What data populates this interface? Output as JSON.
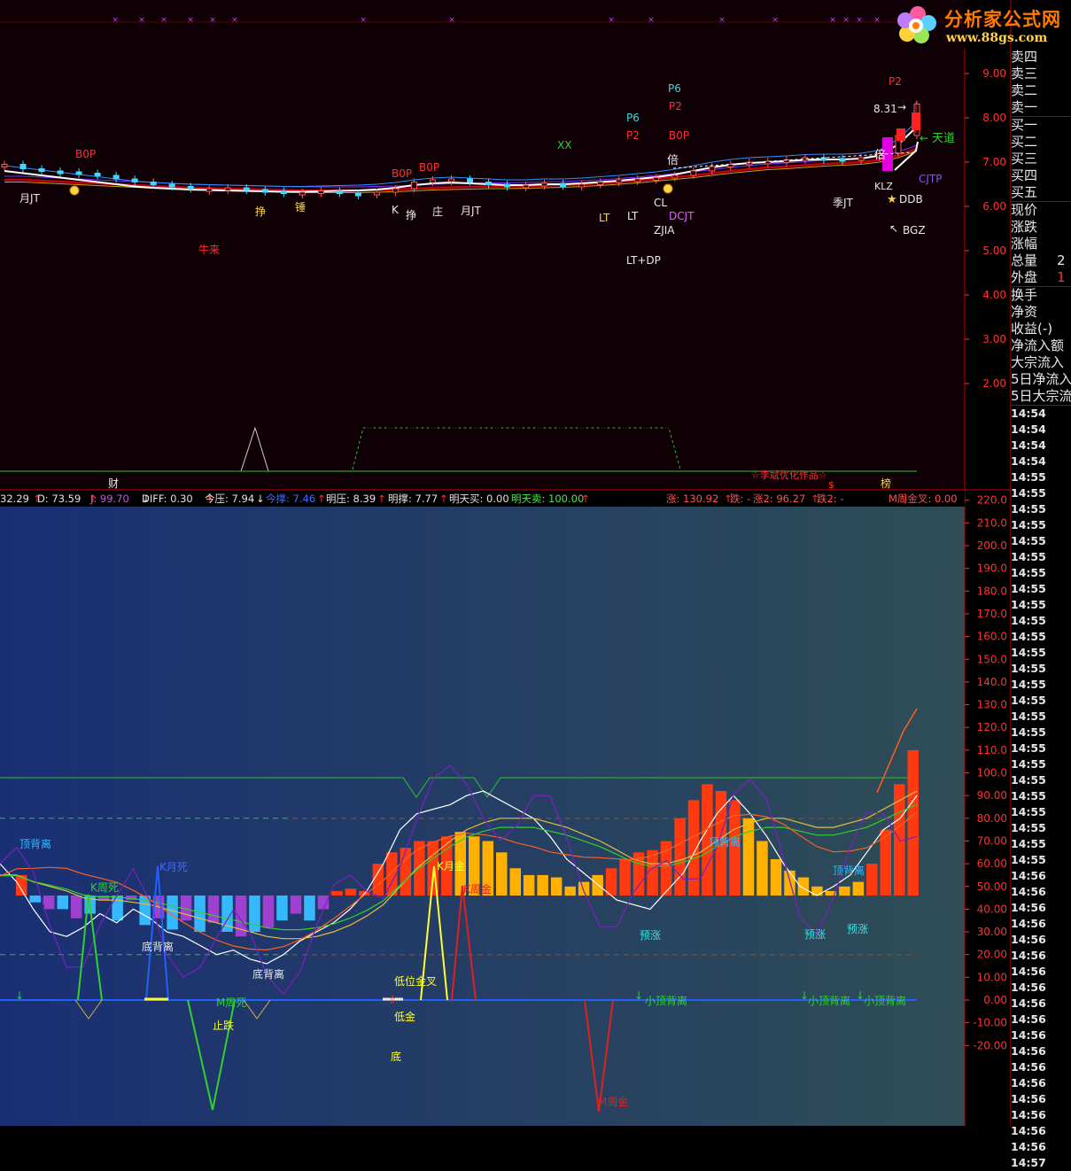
{
  "logo": {
    "title": "分析家公式网",
    "url_text": "www.88gs.com"
  },
  "colors": {
    "upper_bg": "#0f0005",
    "lower_bg_left": "#1a2f73",
    "lower_bg_right": "#2f4d56",
    "up": "#ff2a2a",
    "down": "#36c9ff",
    "grid": "#7a0000"
  },
  "upper_axis": {
    "ticks": [
      "9.00",
      "8.00",
      "7.00",
      "6.00",
      "5.00",
      "4.00",
      "3.00",
      "2.00"
    ]
  },
  "upper_labels": {
    "b0p_1": "B0P",
    "b0p_2": "B0P",
    "b0p_3": "B0P",
    "b0p_4": "B0P",
    "niulai": "牛来",
    "yuejt_1": "月JT",
    "yuejt_2": "月JT",
    "zheng_1": "挣",
    "zheng_2": "挣",
    "zhuang": "庄",
    "chui": "锤",
    "k": "K",
    "lt_1": "LT",
    "lt_2": "LT",
    "p6_1": "P6",
    "p6_2": "P6",
    "p2_1": "P2",
    "p2_2": "P2",
    "p2_3": "P2",
    "xx": "XX",
    "cl": "CL",
    "dcjt": "DCJT",
    "zjia": "ZJIA",
    "ltdp": "LT+DP",
    "bei_1": "倍",
    "bei_2": "倍",
    "price_high": "8.31",
    "tiandao": "天道",
    "cjtp": "CJTP",
    "ddb": "DDB",
    "bgz": "BGZ",
    "jijt": "季JT",
    "kj": "KLZ",
    "cai": "财",
    "credit": "☆李斌优化作品☆",
    "bang": "榜",
    "lian": "$"
  },
  "indicator_bar": [
    {
      "label": "32.29",
      "arrow": "↑",
      "color": "#e0e0e0"
    },
    {
      "label": "D: 73.59",
      "arrow": "↑",
      "color": "#e0e0e0"
    },
    {
      "label": "J: 99.70",
      "arrow": "↓",
      "color": "#c05ad8"
    },
    {
      "label": "DIFF: 0.30",
      "arrow": "↑",
      "color": "#e0e0e0"
    },
    {
      "label": "今压: 7.94",
      "arrow": "↓",
      "color": "#e0e0e0"
    },
    {
      "label": "今撑: 7.46",
      "arrow": "↑",
      "color": "#3d6bff"
    },
    {
      "label": "明压: 8.39",
      "arrow": "↑",
      "color": "#e0e0e0"
    },
    {
      "label": "明撑: 7.77",
      "arrow": "↑",
      "color": "#e0e0e0"
    },
    {
      "label": "明天买: 0.00",
      "arrow": "",
      "color": "#e0e0e0"
    },
    {
      "label": "明天卖: 100.00",
      "arrow": "↑",
      "color": "#49e849"
    },
    {
      "label": "涨: 130.92",
      "arrow": "↑",
      "color": "#ff5050"
    },
    {
      "label": "跌: -",
      "arrow": "",
      "color": "#ff5050"
    },
    {
      "label": "涨2: 96.27",
      "arrow": "↑",
      "color": "#ff5050"
    },
    {
      "label": "跌2: -",
      "arrow": "",
      "color": "#ff5050"
    },
    {
      "label": "M周金叉: 0.00",
      "arrow": "",
      "color": "#ff5050"
    }
  ],
  "lower_axis": {
    "ticks": [
      "220.0",
      "210.0",
      "200.0",
      "190.0",
      "180.0",
      "170.0",
      "160.0",
      "150.0",
      "140.0",
      "130.0",
      "120.0",
      "110.0",
      "100.0",
      "90.00",
      "80.00",
      "70.00",
      "60.00",
      "50.00",
      "40.00",
      "30.00",
      "20.00",
      "10.00",
      "0.00",
      "-10.00",
      "-20.00"
    ]
  },
  "lower_labels": {
    "dingbeili_1": "顶背离",
    "dingbeili_2": "顶背离",
    "dingbeili_3": "顶背离",
    "kyuesi": "K月死",
    "kzhousi": "K周死",
    "dibeili_1": "底背离",
    "dibeili_2": "底背离",
    "mzhousi": "M周死",
    "zhidie": "止跌",
    "kyuejin": "K月金",
    "kzhoujin": "K周金",
    "diweijincha": "低位金叉",
    "dijin": "低金",
    "di": "底",
    "mzhoujin": "M周金",
    "yuzhang_1": "预涨",
    "yuzhang_2": "预涨",
    "yuzhang_3": "预涨",
    "xiaodingbeili_1": "小顶背离",
    "xiaodingbeili_2": "小顶背离",
    "xiaodingbeili_3": "小顶背离"
  },
  "quote_panel": {
    "rows_top": [
      "卖四",
      "卖三",
      "卖二",
      "卖一",
      "买一",
      "买二",
      "买三",
      "买四",
      "买五"
    ],
    "rows_mid": [
      "现价",
      "涨跌",
      "涨幅",
      "总量",
      "外盘"
    ],
    "total_value": "2",
    "outer_value": "1",
    "rows_bot": [
      "换手",
      "净资",
      "收益(-)",
      "净流入额",
      "大宗流入",
      "5日净流入",
      "5日大宗流"
    ]
  },
  "times": [
    "14:54",
    "14:54",
    "14:54",
    "14:54",
    "14:55",
    "14:55",
    "14:55",
    "14:55",
    "14:55",
    "14:55",
    "14:55",
    "14:55",
    "14:55",
    "14:55",
    "14:55",
    "14:55",
    "14:55",
    "14:55",
    "14:55",
    "14:55",
    "14:55",
    "14:55",
    "14:55",
    "14:55",
    "14:55",
    "14:55",
    "14:55",
    "14:55",
    "14:55",
    "14:56",
    "14:56",
    "14:56",
    "14:56",
    "14:56",
    "14:56",
    "14:56",
    "14:56",
    "14:56",
    "14:56",
    "14:56",
    "14:56",
    "14:56",
    "14:56",
    "14:56",
    "14:56",
    "14:56",
    "14:56",
    "14:57"
  ],
  "chart_data": [
    {
      "type": "candlestick",
      "title": "",
      "ylim": [
        1.5,
        9.5
      ],
      "candles": [
        6.95,
        6.85,
        6.8,
        6.78,
        6.75,
        6.7,
        6.62,
        6.55,
        6.5,
        6.45,
        6.4,
        6.4,
        6.42,
        6.38,
        6.35,
        6.3,
        6.32,
        6.35,
        6.3,
        6.28,
        6.32,
        6.4,
        6.55,
        6.6,
        6.62,
        6.55,
        6.5,
        6.45,
        6.48,
        6.52,
        6.45,
        6.5,
        6.55,
        6.6,
        6.62,
        6.65,
        6.7,
        6.8,
        6.9,
        6.95,
        7.0,
        7.02,
        7.05,
        7.1,
        7.08,
        7.05,
        7.1,
        7.2,
        7.6,
        8.31
      ],
      "ma_short": [
        6.8,
        6.75,
        6.7,
        6.65,
        6.6,
        6.55,
        6.5,
        6.45,
        6.42,
        6.4,
        6.38,
        6.37,
        6.36,
        6.35,
        6.34,
        6.33,
        6.33,
        6.34,
        6.35,
        6.36,
        6.38,
        6.42,
        6.48,
        6.52,
        6.54,
        6.52,
        6.5,
        6.48,
        6.48,
        6.5,
        6.5,
        6.52,
        6.55,
        6.58,
        6.62,
        6.66,
        6.72,
        6.8,
        6.88,
        6.94,
        6.98,
        7.0,
        7.02,
        7.05,
        7.06,
        7.06,
        7.08,
        7.15,
        7.4,
        7.8
      ],
      "ma_long": [
        6.6,
        6.6,
        6.58,
        6.56,
        6.54,
        6.52,
        6.5,
        6.48,
        6.46,
        6.44,
        6.42,
        6.41,
        6.4,
        6.39,
        6.38,
        6.37,
        6.36,
        6.36,
        6.36,
        6.36,
        6.37,
        6.38,
        6.4,
        6.42,
        6.43,
        6.44,
        6.45,
        6.45,
        6.46,
        6.47,
        6.48,
        6.5,
        6.52,
        6.55,
        6.58,
        6.62,
        6.66,
        6.7,
        6.75,
        6.8,
        6.84,
        6.88,
        6.9,
        6.93,
        6.96,
        6.98,
        7.0,
        7.05,
        7.15,
        7.3
      ]
    },
    {
      "type": "bar",
      "title": "",
      "ylim": [
        -20,
        220
      ],
      "values": [
        55,
        43,
        40,
        40,
        36,
        38,
        44,
        35,
        44,
        33,
        36,
        31,
        35,
        30,
        34,
        30,
        28,
        30,
        32,
        35,
        38,
        35,
        40,
        48,
        49,
        48,
        60,
        65,
        67,
        70,
        70,
        72,
        74,
        72,
        70,
        65,
        58,
        55,
        55,
        54,
        50,
        52,
        55,
        58,
        62,
        65,
        66,
        70,
        80,
        88,
        95,
        92,
        88,
        80,
        70,
        62,
        57,
        54,
        50,
        48,
        50,
        52,
        60,
        75,
        95,
        110
      ]
    }
  ]
}
